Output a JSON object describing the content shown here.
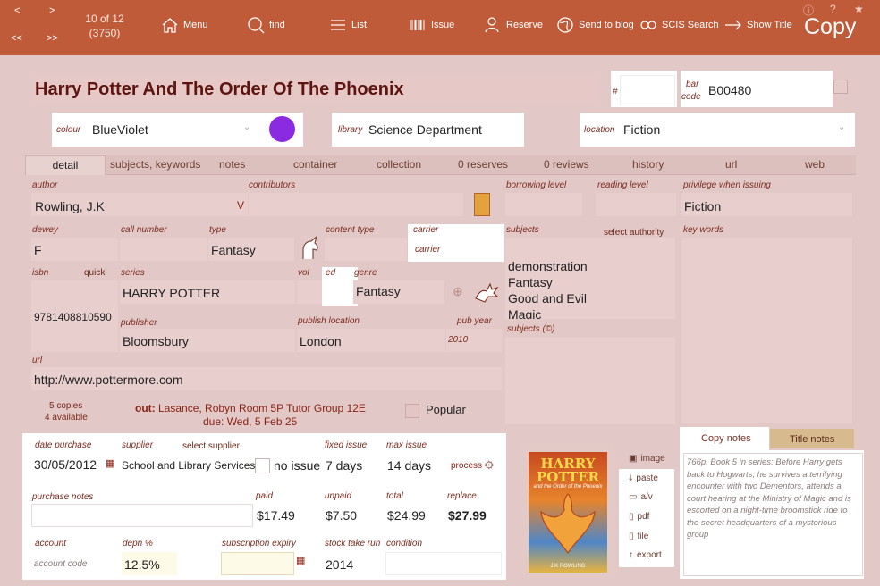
{
  "nav": {
    "prev": "<",
    "next": ">",
    "first": "<<",
    "last": ">>",
    "counter": "10 of 12",
    "record_id": "(3750)"
  },
  "toolbar": [
    {
      "label": "Menu",
      "icon": "home-icon"
    },
    {
      "label": "find",
      "icon": "search-icon"
    },
    {
      "label": "List",
      "icon": "list-icon"
    },
    {
      "label": "Issue",
      "icon": "barcode-icon"
    },
    {
      "label": "Reserve",
      "icon": "user-icon"
    },
    {
      "label": "Send to blog",
      "icon": "globe-icon"
    },
    {
      "label": "SCIS Search",
      "icon": "scis-icon"
    },
    {
      "label": "Show Title",
      "icon": "arrow-right-icon"
    }
  ],
  "copy_label": "Copy",
  "title": "Harry Potter And The Order Of The Phoenix",
  "hash_label": "#",
  "barcode": {
    "label1": "bar",
    "label2": "code",
    "value": "B00480"
  },
  "colour": {
    "label": "colour",
    "value": "BlueViolet",
    "swatch": "#8a2be2"
  },
  "library": {
    "label": "library",
    "value": "Science Department"
  },
  "location": {
    "label": "location",
    "value": "Fiction"
  },
  "tabs": [
    "detail",
    "subjects, keywords",
    "notes",
    "container",
    "collection",
    "0 reserves",
    "0 reviews",
    "history",
    "url",
    "web"
  ],
  "author": {
    "label": "author",
    "value": "Rowling, J.K",
    "flag": "V"
  },
  "contributors": {
    "label": "contributors"
  },
  "borrowing_level": {
    "label": "borrowing level"
  },
  "reading_level": {
    "label": "reading level"
  },
  "privilege": {
    "label": "privilege when issuing",
    "value": "Fiction"
  },
  "dewey": {
    "label": "dewey",
    "value": "F"
  },
  "call_number": {
    "label": "call number"
  },
  "type": {
    "label": "type",
    "value": "Fantasy"
  },
  "content_type": {
    "label": "content type"
  },
  "carrier": {
    "label": "carrier",
    "placeholder": "carrier"
  },
  "subjects": {
    "label": "subjects",
    "select": "select authority",
    "items": [
      "demonstration",
      "Fantasy",
      "Good and Evil",
      "Magic"
    ]
  },
  "key_words": {
    "label": "key words"
  },
  "isbn": {
    "label": "isbn",
    "quick": "quick",
    "value": "9781408810590"
  },
  "series": {
    "label": "series",
    "value": "HARRY POTTER"
  },
  "vol": {
    "label": "vol"
  },
  "ed": {
    "label": "ed"
  },
  "genre": {
    "label": "genre",
    "value": "Fantasy"
  },
  "publisher": {
    "label": "publisher",
    "value": "Bloomsbury"
  },
  "publish_location": {
    "label": "publish location",
    "value": "London"
  },
  "pub_year": {
    "label": "pub year",
    "value": "2010"
  },
  "subjects_c": {
    "label": "subjects (©)"
  },
  "url": {
    "label": "url",
    "value": "http://www.pottermore.com"
  },
  "copies": {
    "count": "5 copies",
    "available": "4 available"
  },
  "loan": {
    "out_label": "out:",
    "borrower": "Lasance, Robyn Room 5P Tutor Group 12E",
    "due": "due: Wed, 5 Feb 25"
  },
  "popular": "Popular",
  "date_purchase": {
    "label": "date purchase",
    "value": "30/05/2012"
  },
  "supplier": {
    "label": "supplier",
    "select": "select supplier",
    "value": "School and Library Services"
  },
  "no_issue": "no issue",
  "fixed_issue": {
    "label": "fixed issue",
    "value": "7 days"
  },
  "max_issue": {
    "label": "max issue",
    "value": "14 days"
  },
  "process": "process",
  "purchase_notes": {
    "label": "purchase notes"
  },
  "paid": {
    "label": "paid",
    "value": "$17.49"
  },
  "unpaid": {
    "label": "unpaid",
    "value": "$7.50"
  },
  "total": {
    "label": "total",
    "value": "$24.99"
  },
  "replace": {
    "label": "replace",
    "value": "$27.99"
  },
  "account": {
    "label": "account",
    "placeholder": "account code"
  },
  "depn": {
    "label": "depn %",
    "value": "12.5%"
  },
  "subscription": {
    "label": "subscription expiry"
  },
  "stocktake": {
    "label": "stock take run",
    "value": "2014"
  },
  "condition": {
    "label": "condition"
  },
  "cover": {
    "line1": "HARRY",
    "line2": "POTTER",
    "line3": "and the Order of the Phoenix",
    "author": "J.K ROWLING"
  },
  "media_actions": [
    "image",
    "paste",
    "a/v",
    "pdf",
    "file",
    "export"
  ],
  "notes_tabs": [
    "Copy notes",
    "Title notes"
  ],
  "notes_text": "766p. Book 5 in series: Before Harry gets back to Hogwarts, he survives a terrifying encounter with two Dementors, attends a court hearing at the Ministry of Magic and is escorted on a night-time broomstick ride to the secret headquarters of a mysterious group"
}
